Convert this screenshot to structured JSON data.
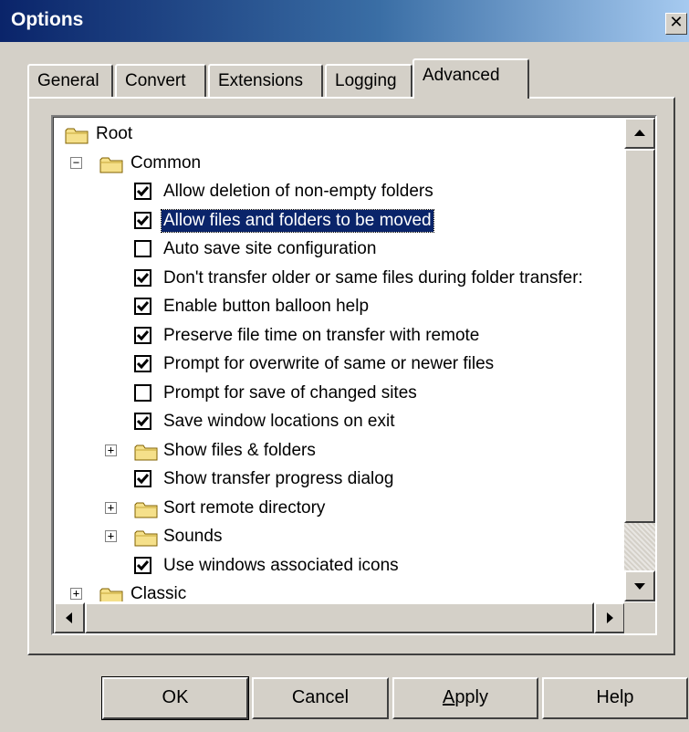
{
  "window": {
    "title": "Options",
    "close_glyph": "✕"
  },
  "tabs": [
    {
      "label": "General",
      "active": false
    },
    {
      "label": "Convert",
      "active": false
    },
    {
      "label": "Extensions",
      "active": false
    },
    {
      "label": "Logging",
      "active": false
    },
    {
      "label": "Advanced",
      "active": true
    }
  ],
  "tree": {
    "root": {
      "label": "Root",
      "icon": "folder-icon"
    },
    "common": {
      "label": "Common",
      "icon": "folder-icon",
      "expander": "−"
    },
    "items": [
      {
        "type": "check",
        "label": "Allow deletion of non-empty folders",
        "checked": true
      },
      {
        "type": "check",
        "label": "Allow files and folders to be moved",
        "checked": true,
        "selected": true
      },
      {
        "type": "check",
        "label": "Auto save site configuration",
        "checked": false
      },
      {
        "type": "check",
        "label": "Don't transfer older or same files during folder transfer:",
        "checked": true
      },
      {
        "type": "check",
        "label": "Enable button balloon help",
        "checked": true
      },
      {
        "type": "check",
        "label": "Preserve file time on transfer with remote",
        "checked": true
      },
      {
        "type": "check",
        "label": "Prompt for overwrite of same or newer files",
        "checked": true
      },
      {
        "type": "check",
        "label": "Prompt for save of changed sites",
        "checked": false
      },
      {
        "type": "check",
        "label": "Save window locations on exit",
        "checked": true
      },
      {
        "type": "folder",
        "label": "Show files & folders",
        "expander": "+"
      },
      {
        "type": "check",
        "label": "Show transfer progress dialog",
        "checked": true
      },
      {
        "type": "folder",
        "label": "Sort remote directory",
        "expander": "+"
      },
      {
        "type": "folder",
        "label": "Sounds",
        "expander": "+"
      },
      {
        "type": "check",
        "label": "Use windows associated icons",
        "checked": true
      }
    ],
    "partial": {
      "label": "Classic",
      "expander": "+"
    }
  },
  "buttons": {
    "ok": "OK",
    "cancel": "Cancel",
    "apply_mnemonic": "A",
    "apply_rest": "pply",
    "help": "Help"
  },
  "colors": {
    "selection": "#0a246a",
    "face": "#d4d0c8"
  }
}
